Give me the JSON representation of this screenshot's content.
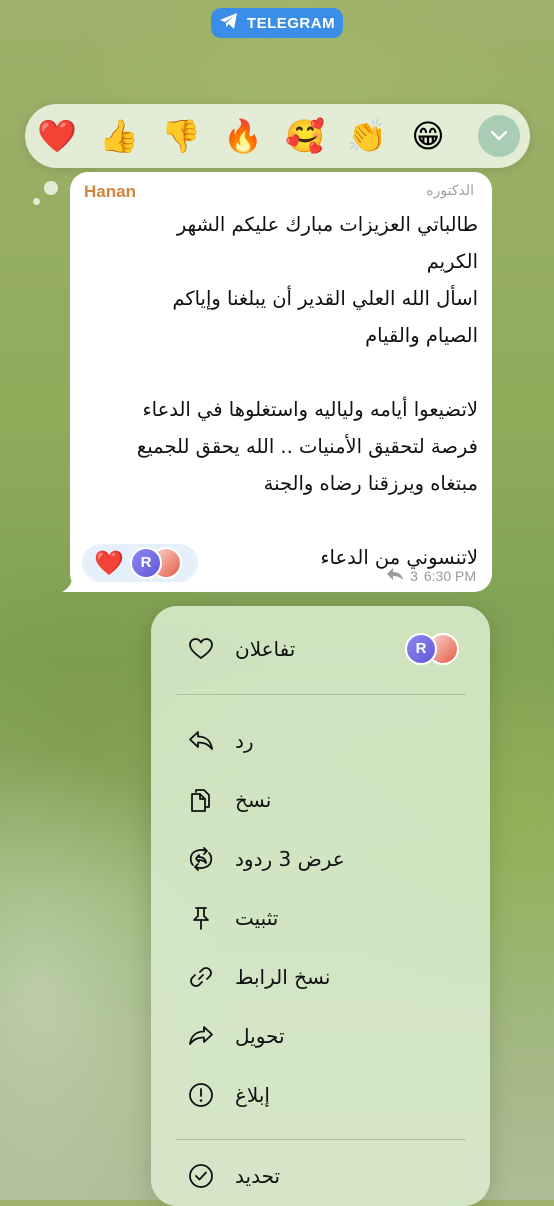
{
  "badge": {
    "label": "TELEGRAM",
    "icon": "telegram-icon"
  },
  "reaction_bar": {
    "emojis": [
      {
        "name": "heart",
        "glyph": "❤️"
      },
      {
        "name": "thumbs-up",
        "glyph": "👍"
      },
      {
        "name": "thumbs-down",
        "glyph": "👎"
      },
      {
        "name": "fire",
        "glyph": "🔥"
      },
      {
        "name": "smiling-face-with-hearts",
        "glyph": "🥰"
      },
      {
        "name": "clapping-hands",
        "glyph": "👏"
      },
      {
        "name": "beaming-face",
        "glyph": "😁"
      }
    ],
    "expand_icon": "chevron-down-icon"
  },
  "message": {
    "sender": "Hanan",
    "author_signature": "الدكتوره",
    "text": "طالباتي العزيزات مبارك عليكم الشهر\nالكريم\nاسأل الله العلي القدير أن يبلغنا وإياكم\nالصيام والقيام\n\nلاتضيعوا أيامه ولياليه واستغلوها في الدعاء\nفرصة لتحقيق الأمنيات .. الله يحقق للجميع\nمبتغاه ويرزقنا رضاه والجنة\n\nلاتنسوني من الدعاء",
    "reaction": {
      "glyph": "❤️"
    },
    "reactor_initial": "R",
    "reply_count": "3",
    "time": "6:30 PM"
  },
  "context_menu": {
    "reactions_item": {
      "label": "تفاعلان",
      "avatar_initial": "R"
    },
    "items": [
      {
        "id": "reply",
        "label": "رد",
        "icon": "reply-icon"
      },
      {
        "id": "copy",
        "label": "نسخ",
        "icon": "copy-icon"
      },
      {
        "id": "view_replies",
        "label": "عرض 3 ردود",
        "icon": "view-replies-icon"
      },
      {
        "id": "pin",
        "label": "تثبيت",
        "icon": "pin-icon"
      },
      {
        "id": "copy_link",
        "label": "نسخ الرابط",
        "icon": "link-icon"
      },
      {
        "id": "forward",
        "label": "تحويل",
        "icon": "forward-icon"
      },
      {
        "id": "report",
        "label": "إبلاغ",
        "icon": "report-icon"
      },
      {
        "id": "select",
        "label": "تحديد",
        "icon": "select-icon"
      }
    ]
  },
  "colors": {
    "badge_bg": "#3b8ee8",
    "sender_name": "#d0843c",
    "reaction_chip_bg": "#e6f0fa",
    "menu_bg": "#daeccd"
  }
}
